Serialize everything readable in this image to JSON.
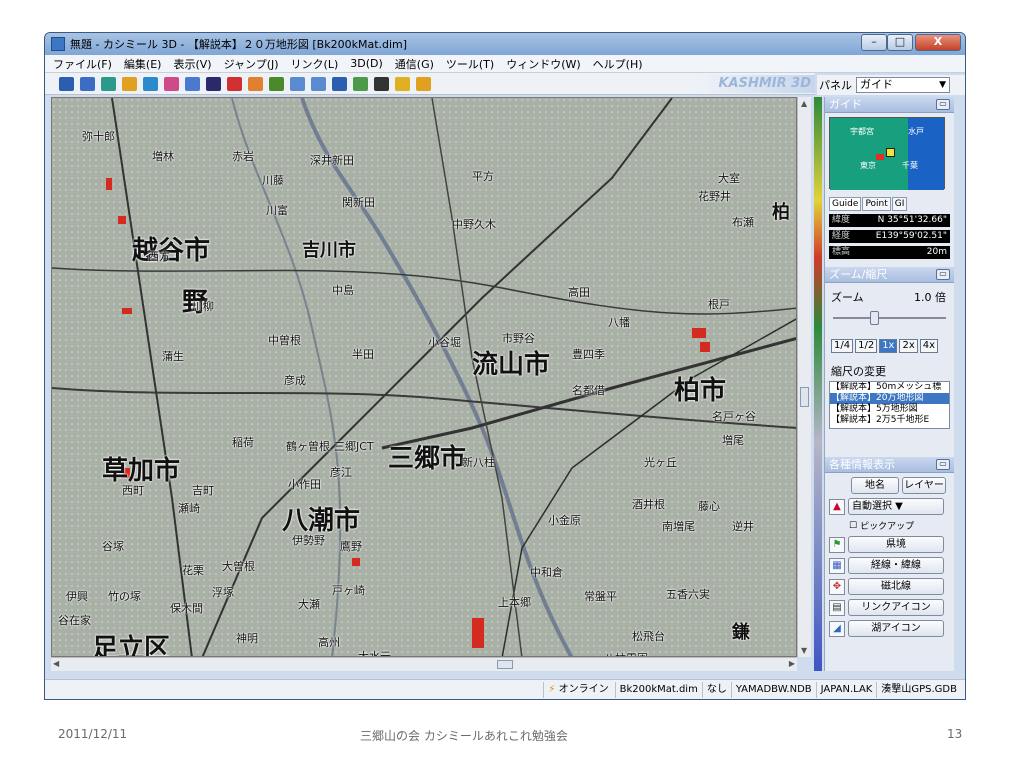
{
  "window": {
    "title": "無題 - カシミール 3D - 【解説本】２０万地形図 [Bk200kMat.dim]",
    "min_label": "–",
    "max_label": "□",
    "close_label": "X"
  },
  "menu": [
    "ファイル(F)",
    "編集(E)",
    "表示(V)",
    "ジャンプ(J)",
    "リンク(L)",
    "3D(D)",
    "通信(G)",
    "ツール(T)",
    "ウィンドウ(W)",
    "ヘルプ(H)"
  ],
  "toolbar": {
    "brand": "KASHMIR 3D",
    "icons": [
      "zoom-position-icon",
      "pen-icon",
      "stamp-icon",
      "stamp2-icon",
      "stamp3-icon",
      "stamp4-icon",
      "stamp5-icon",
      "binoculars-icon",
      "brush-icon",
      "eraser-icon",
      "ruler-icon",
      "arrow-left-icon",
      "arrow-right-icon",
      "camera-icon",
      "table-icon",
      "save-icon",
      "help-icon",
      "flag-icon"
    ]
  },
  "panel": {
    "label": "パネル",
    "selected": "ガイド",
    "guide": {
      "header": "ガイド",
      "map_labels": [
        "宇都宮",
        "水戸",
        "東京",
        "千葉"
      ],
      "tabs": [
        "Guide",
        "Point",
        "GI"
      ],
      "lat_label": "緯度",
      "lat_value": "N 35°51'32.66\"",
      "lon_label": "経度",
      "lon_value": "E139°59'02.51\"",
      "elev_label": "標高",
      "elev_value": "20m"
    },
    "zoom": {
      "header": "ズーム/縮尺",
      "label": "ズーム",
      "value": "1.0 倍",
      "level": 0.33,
      "buttons": [
        "1/4",
        "1/2",
        "1x",
        "2x",
        "4x"
      ],
      "selected_button": "1x",
      "scale_change_label": "縮尺の変更",
      "scales": [
        "【解説本】50mメッシュ標",
        "【解説本】20万地形図",
        "【解説本】5万地形図",
        "【解説本】2万5千地形E"
      ],
      "selected_scale_index": 1
    },
    "info": {
      "header": "各種情報表示",
      "place_name_button": "地名",
      "layer_button": "レイヤー",
      "auto_select": "自動選択",
      "pickup_label": "ピックアップ",
      "buttons": [
        "県境",
        "経線・緯線",
        "磁北線",
        "リンクアイコン",
        "湖アイコン"
      ]
    }
  },
  "map": {
    "labels": [
      {
        "text": "越谷市",
        "size": "big"
      },
      {
        "text": "吉川市",
        "size": "mid"
      },
      {
        "text": "野",
        "size": "big"
      },
      {
        "text": "流山市",
        "size": "big"
      },
      {
        "text": "柏市",
        "size": "big"
      },
      {
        "text": "草加市",
        "size": "big"
      },
      {
        "text": "八潮市",
        "size": "big"
      },
      {
        "text": "三郷市",
        "size": "big"
      },
      {
        "text": "足立区",
        "size": "big"
      },
      {
        "text": "弥十郎",
        "size": "place"
      },
      {
        "text": "増林",
        "size": "place"
      },
      {
        "text": "赤岩",
        "size": "place"
      },
      {
        "text": "深井新田",
        "size": "place"
      },
      {
        "text": "平方",
        "size": "place"
      },
      {
        "text": "大室",
        "size": "place"
      },
      {
        "text": "花野井",
        "size": "place"
      },
      {
        "text": "中野久木",
        "size": "place"
      },
      {
        "text": "布瀬",
        "size": "place"
      },
      {
        "text": "川藤",
        "size": "place"
      },
      {
        "text": "川富",
        "size": "place"
      },
      {
        "text": "関新田",
        "size": "place"
      },
      {
        "text": "西方",
        "size": "place"
      },
      {
        "text": "中島",
        "size": "place"
      },
      {
        "text": "高田",
        "size": "place"
      },
      {
        "text": "根戸",
        "size": "place"
      },
      {
        "text": "八幡",
        "size": "place"
      },
      {
        "text": "川柳",
        "size": "place"
      },
      {
        "text": "中曽根",
        "size": "place"
      },
      {
        "text": "半田",
        "size": "place"
      },
      {
        "text": "小谷堀",
        "size": "place"
      },
      {
        "text": "市野谷",
        "size": "place"
      },
      {
        "text": "豊四季",
        "size": "place"
      },
      {
        "text": "蒲生",
        "size": "place"
      },
      {
        "text": "彦成",
        "size": "place"
      },
      {
        "text": "名都借",
        "size": "place"
      },
      {
        "text": "名戸ヶ谷",
        "size": "place"
      },
      {
        "text": "増尾",
        "size": "place"
      },
      {
        "text": "稲荷",
        "size": "place"
      },
      {
        "text": "鶴ヶ曽根",
        "size": "place"
      },
      {
        "text": "三郷JCT",
        "size": "place"
      },
      {
        "text": "彦江",
        "size": "place"
      },
      {
        "text": "新八柱",
        "size": "place"
      },
      {
        "text": "光ヶ丘",
        "size": "place"
      },
      {
        "text": "酒井根",
        "size": "place"
      },
      {
        "text": "南増尾",
        "size": "place"
      },
      {
        "text": "逆井",
        "size": "place"
      },
      {
        "text": "藤心",
        "size": "place"
      },
      {
        "text": "西町",
        "size": "place"
      },
      {
        "text": "吉町",
        "size": "place"
      },
      {
        "text": "瀬崎",
        "size": "place"
      },
      {
        "text": "小作田",
        "size": "place"
      },
      {
        "text": "伊勢野",
        "size": "place"
      },
      {
        "text": "鷹野",
        "size": "place"
      },
      {
        "text": "小金原",
        "size": "place"
      },
      {
        "text": "谷塚",
        "size": "place"
      },
      {
        "text": "花栗",
        "size": "place"
      },
      {
        "text": "大曽根",
        "size": "place"
      },
      {
        "text": "浮塚",
        "size": "place"
      },
      {
        "text": "戸ヶ崎",
        "size": "place"
      },
      {
        "text": "大瀬",
        "size": "place"
      },
      {
        "text": "中和倉",
        "size": "place"
      },
      {
        "text": "上本郷",
        "size": "place"
      },
      {
        "text": "常盤平",
        "size": "place"
      },
      {
        "text": "五香六実",
        "size": "place"
      },
      {
        "text": "伊興",
        "size": "place"
      },
      {
        "text": "竹の塚",
        "size": "place"
      },
      {
        "text": "保木間",
        "size": "place"
      },
      {
        "text": "谷在家",
        "size": "place"
      },
      {
        "text": "神明",
        "size": "place"
      },
      {
        "text": "高州",
        "size": "place"
      },
      {
        "text": "大水元",
        "size": "place"
      },
      {
        "text": "松飛台",
        "size": "place"
      },
      {
        "text": "八柱霊園",
        "size": "place"
      },
      {
        "text": "鎌",
        "size": "mid"
      },
      {
        "text": "柏",
        "size": "mid"
      }
    ]
  },
  "status": {
    "online": "オンライン",
    "cells": [
      "Bk200kMat.dim",
      "なし",
      "YAMADBW.NDB",
      "JAPAN.LAK",
      "湊撃山GPS.GDB"
    ]
  },
  "footer": {
    "date": "2011/12/11",
    "caption": "三郷山の会 カシミールあれこれ勉強会",
    "page": "13"
  }
}
